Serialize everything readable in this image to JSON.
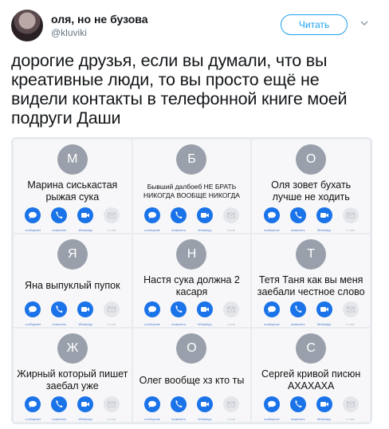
{
  "tweet": {
    "author_name": "оля, но не бузова",
    "handle": "@kluviki",
    "follow_label": "Читать",
    "text": "дорогие друзья, если вы думали, что вы креативные люди, то вы просто ещё не видели контакты в телефонной книге моей подруги Даши"
  },
  "icons": {
    "avatar": "avatar-photo",
    "chevron": "chevron-down-icon",
    "message": "message-bubble-icon",
    "call": "phone-icon",
    "video": "video-camera-icon",
    "mail": "mail-icon"
  },
  "colors": {
    "accent": "#1da1f2",
    "ios_blue": "#1a73e8",
    "avatar_gray": "#9aa0ab"
  },
  "action_labels": [
    "сообщение",
    "позвонить",
    "WhatsApp",
    "e-mail"
  ],
  "contacts": [
    {
      "letter": "М",
      "name": "Марина сиськастая рыжая сука",
      "small": false
    },
    {
      "letter": "Б",
      "name": "Бывший далбоеб НЕ БРАТЬ НИКОГДА ВООБЩЕ НИКОГДА",
      "small": true
    },
    {
      "letter": "О",
      "name": "Оля зовет бухать лучше не ходить",
      "small": false
    },
    {
      "letter": "Я",
      "name": "Яна выпуклый пупок",
      "small": false
    },
    {
      "letter": "Н",
      "name": "Настя сука должна 2 касаря",
      "small": false
    },
    {
      "letter": "Т",
      "name": "Тетя Таня как вы меня заебали честное слово",
      "small": false
    },
    {
      "letter": "Ж",
      "name": "Жирный который пишет заебал уже",
      "small": false
    },
    {
      "letter": "О",
      "name": "Олег вообще хз кто ты",
      "small": false
    },
    {
      "letter": "С",
      "name": "Сергей кривой писюн АХАХАХА",
      "small": false
    }
  ]
}
